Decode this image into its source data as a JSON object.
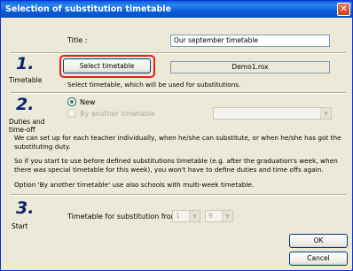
{
  "window": {
    "title": "Selection of substitution timetable",
    "close_glyph": "✕"
  },
  "title_row": {
    "label": "Title :",
    "value": "Our september timetable"
  },
  "step1": {
    "number": "1.",
    "label": "Timetable",
    "select_button": "Select timetable",
    "file_name": "Demo1.rox",
    "hint": "Select timetable, which will be used for substitutions."
  },
  "step2": {
    "number": "2.",
    "label_line1": "Duties and",
    "label_line2": "time-off",
    "radio_new": "New",
    "radio_another": "By another timetable",
    "another_combo_value": "",
    "para1": "We can set up for each teacher individually, when he/she can substitute, or when he/she has got the substituting duty.",
    "para2": "So if you start to use before defined substitutions timetable (e.g. after the graduation's week, when there was special timetable for this week), you won't have to define duties and time offs again.",
    "para3": "Option 'By another timetable' use also schools with multi-week timetable."
  },
  "step3": {
    "number": "3.",
    "label": "Start",
    "from_label": "Timetable for substitution from :",
    "day_value": "1",
    "month_value": "9"
  },
  "buttons": {
    "ok": "OK",
    "cancel": "Cancel"
  },
  "colors": {
    "highlight": "#e8201a",
    "titlebar": "#0a5fd8",
    "step_number": "#0a246a"
  }
}
